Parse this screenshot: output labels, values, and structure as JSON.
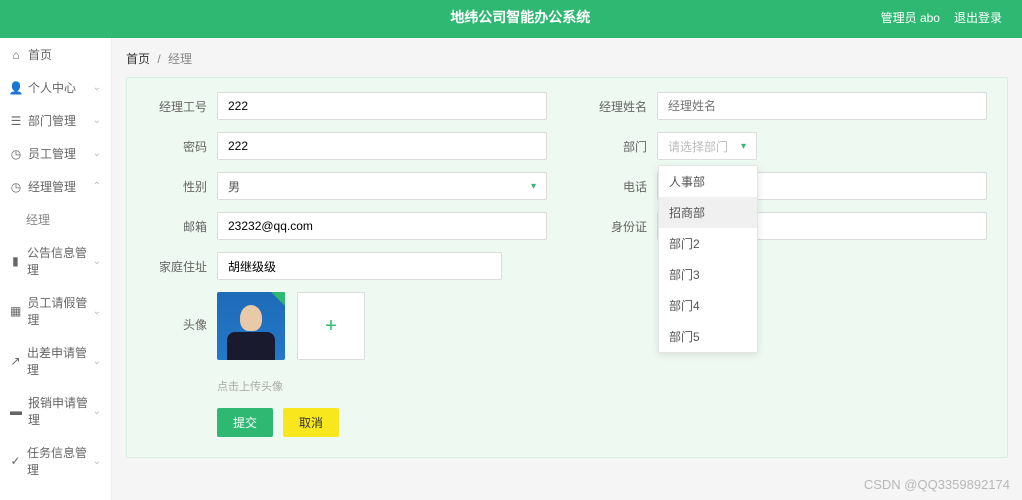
{
  "header": {
    "title": "地纬公司智能办公系统",
    "admin_label": "管理员 abo",
    "logout_label": "退出登录"
  },
  "sidebar": {
    "items": [
      {
        "icon": "home",
        "label": "首页"
      },
      {
        "icon": "user",
        "label": "个人中心"
      },
      {
        "icon": "list",
        "label": "部门管理"
      },
      {
        "icon": "clock",
        "label": "员工管理"
      },
      {
        "icon": "clock",
        "label": "经理管理"
      },
      {
        "icon": "chart",
        "label": "公告信息管理"
      },
      {
        "icon": "calendar",
        "label": "员工请假管理"
      },
      {
        "icon": "arrow",
        "label": "出差申请管理"
      },
      {
        "icon": "money",
        "label": "报销申请管理"
      },
      {
        "icon": "task",
        "label": "任务信息管理"
      }
    ],
    "sub_item": "经理"
  },
  "breadcrumb": {
    "home": "首页",
    "current": "经理"
  },
  "form": {
    "labels": {
      "manager_id": "经理工号",
      "manager_name": "经理姓名",
      "password": "密码",
      "department": "部门",
      "gender": "性别",
      "phone": "电话",
      "email": "邮箱",
      "id_card": "身份证",
      "address": "家庭住址",
      "avatar": "头像"
    },
    "values": {
      "manager_id": "222",
      "password": "222",
      "gender": "男",
      "email": "23232@qq.com",
      "address": "胡继级级"
    },
    "placeholders": {
      "manager_name": "经理姓名",
      "department": "请选择部门"
    },
    "department_options": [
      "人事部",
      "招商部",
      "部门2",
      "部门3",
      "部门4",
      "部门5"
    ],
    "avatar_hint": "点击上传头像",
    "submit": "提交",
    "cancel": "取消"
  },
  "watermark": "CSDN @QQ3359892174"
}
